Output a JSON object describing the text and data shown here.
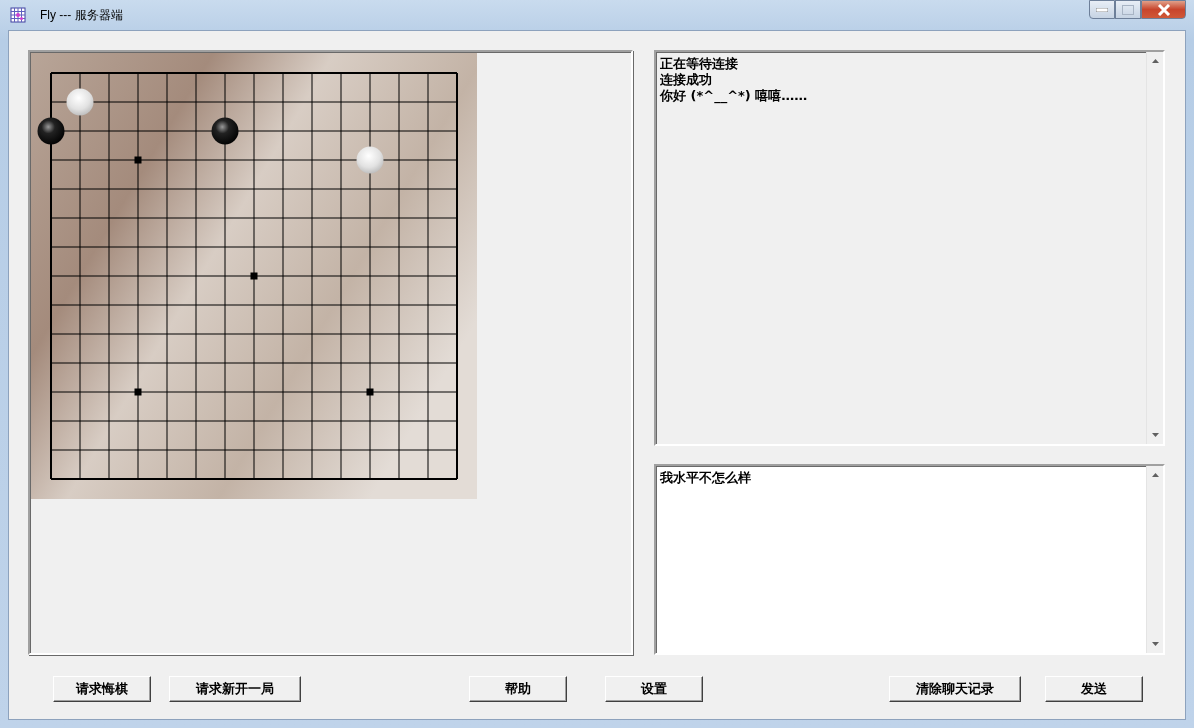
{
  "window": {
    "title": "Fly --- 服务器端"
  },
  "board": {
    "rows": [
      {
        "points": [
          {
            "kind": "empty"
          },
          {
            "kind": "empty"
          },
          {
            "kind": "empty"
          },
          {
            "kind": "empty"
          },
          {
            "kind": "empty"
          },
          {
            "kind": "empty"
          },
          {
            "kind": "empty"
          },
          {
            "kind": "empty"
          },
          {
            "kind": "empty"
          },
          {
            "kind": "empty"
          },
          {
            "kind": "empty"
          },
          {
            "kind": "empty"
          },
          {
            "kind": "empty"
          },
          {
            "kind": "empty"
          },
          {
            "kind": "empty"
          }
        ]
      },
      {
        "points": [
          {
            "kind": "empty"
          },
          {
            "kind": "white"
          },
          {
            "kind": "empty"
          },
          {
            "kind": "empty"
          },
          {
            "kind": "empty"
          },
          {
            "kind": "empty"
          },
          {
            "kind": "empty"
          },
          {
            "kind": "empty"
          },
          {
            "kind": "empty"
          },
          {
            "kind": "empty"
          },
          {
            "kind": "empty"
          },
          {
            "kind": "empty"
          },
          {
            "kind": "empty"
          },
          {
            "kind": "empty"
          },
          {
            "kind": "empty"
          }
        ]
      },
      {
        "points": [
          {
            "kind": "black"
          },
          {
            "kind": "empty"
          },
          {
            "kind": "empty"
          },
          {
            "kind": "empty"
          },
          {
            "kind": "empty"
          },
          {
            "kind": "empty"
          },
          {
            "kind": "black"
          },
          {
            "kind": "empty"
          },
          {
            "kind": "empty"
          },
          {
            "kind": "empty"
          },
          {
            "kind": "empty"
          },
          {
            "kind": "empty"
          },
          {
            "kind": "empty"
          },
          {
            "kind": "empty"
          },
          {
            "kind": "empty"
          }
        ]
      },
      {
        "points": [
          {
            "kind": "empty"
          },
          {
            "kind": "empty"
          },
          {
            "kind": "empty"
          },
          {
            "kind": "empty"
          },
          {
            "kind": "empty"
          },
          {
            "kind": "empty"
          },
          {
            "kind": "empty"
          },
          {
            "kind": "empty"
          },
          {
            "kind": "empty"
          },
          {
            "kind": "empty"
          },
          {
            "kind": "empty"
          },
          {
            "kind": "white"
          },
          {
            "kind": "empty"
          },
          {
            "kind": "empty"
          },
          {
            "kind": "empty"
          }
        ]
      },
      {
        "points": [
          {
            "kind": "empty"
          },
          {
            "kind": "empty"
          },
          {
            "kind": "empty"
          },
          {
            "kind": "empty"
          },
          {
            "kind": "empty"
          },
          {
            "kind": "empty"
          },
          {
            "kind": "empty"
          },
          {
            "kind": "empty"
          },
          {
            "kind": "empty"
          },
          {
            "kind": "empty"
          },
          {
            "kind": "empty"
          },
          {
            "kind": "empty"
          },
          {
            "kind": "empty"
          },
          {
            "kind": "empty"
          },
          {
            "kind": "empty"
          }
        ]
      },
      {
        "points": [
          {
            "kind": "empty"
          },
          {
            "kind": "empty"
          },
          {
            "kind": "empty"
          },
          {
            "kind": "empty"
          },
          {
            "kind": "empty"
          },
          {
            "kind": "empty"
          },
          {
            "kind": "empty"
          },
          {
            "kind": "empty"
          },
          {
            "kind": "empty"
          },
          {
            "kind": "empty"
          },
          {
            "kind": "empty"
          },
          {
            "kind": "empty"
          },
          {
            "kind": "empty"
          },
          {
            "kind": "empty"
          },
          {
            "kind": "empty"
          }
        ]
      },
      {
        "points": [
          {
            "kind": "empty"
          },
          {
            "kind": "empty"
          },
          {
            "kind": "empty"
          },
          {
            "kind": "empty"
          },
          {
            "kind": "empty"
          },
          {
            "kind": "empty"
          },
          {
            "kind": "empty"
          },
          {
            "kind": "empty"
          },
          {
            "kind": "empty"
          },
          {
            "kind": "empty"
          },
          {
            "kind": "empty"
          },
          {
            "kind": "empty"
          },
          {
            "kind": "empty"
          },
          {
            "kind": "empty"
          },
          {
            "kind": "empty"
          }
        ]
      },
      {
        "points": [
          {
            "kind": "empty"
          },
          {
            "kind": "empty"
          },
          {
            "kind": "empty"
          },
          {
            "kind": "empty"
          },
          {
            "kind": "empty"
          },
          {
            "kind": "empty"
          },
          {
            "kind": "empty"
          },
          {
            "kind": "empty"
          },
          {
            "kind": "empty"
          },
          {
            "kind": "empty"
          },
          {
            "kind": "empty"
          },
          {
            "kind": "empty"
          },
          {
            "kind": "empty"
          },
          {
            "kind": "empty"
          },
          {
            "kind": "empty"
          }
        ]
      },
      {
        "points": [
          {
            "kind": "empty"
          },
          {
            "kind": "empty"
          },
          {
            "kind": "empty"
          },
          {
            "kind": "empty"
          },
          {
            "kind": "empty"
          },
          {
            "kind": "empty"
          },
          {
            "kind": "empty"
          },
          {
            "kind": "empty"
          },
          {
            "kind": "empty"
          },
          {
            "kind": "empty"
          },
          {
            "kind": "empty"
          },
          {
            "kind": "empty"
          },
          {
            "kind": "empty"
          },
          {
            "kind": "empty"
          },
          {
            "kind": "empty"
          }
        ]
      },
      {
        "points": [
          {
            "kind": "empty"
          },
          {
            "kind": "empty"
          },
          {
            "kind": "empty"
          },
          {
            "kind": "empty"
          },
          {
            "kind": "empty"
          },
          {
            "kind": "empty"
          },
          {
            "kind": "empty"
          },
          {
            "kind": "empty"
          },
          {
            "kind": "empty"
          },
          {
            "kind": "empty"
          },
          {
            "kind": "empty"
          },
          {
            "kind": "empty"
          },
          {
            "kind": "empty"
          },
          {
            "kind": "empty"
          },
          {
            "kind": "empty"
          }
        ]
      },
      {
        "points": [
          {
            "kind": "empty"
          },
          {
            "kind": "empty"
          },
          {
            "kind": "empty"
          },
          {
            "kind": "empty"
          },
          {
            "kind": "empty"
          },
          {
            "kind": "empty"
          },
          {
            "kind": "empty"
          },
          {
            "kind": "empty"
          },
          {
            "kind": "empty"
          },
          {
            "kind": "empty"
          },
          {
            "kind": "empty"
          },
          {
            "kind": "empty"
          },
          {
            "kind": "empty"
          },
          {
            "kind": "empty"
          },
          {
            "kind": "empty"
          }
        ]
      },
      {
        "points": [
          {
            "kind": "empty"
          },
          {
            "kind": "empty"
          },
          {
            "kind": "empty"
          },
          {
            "kind": "empty"
          },
          {
            "kind": "empty"
          },
          {
            "kind": "empty"
          },
          {
            "kind": "empty"
          },
          {
            "kind": "empty"
          },
          {
            "kind": "empty"
          },
          {
            "kind": "empty"
          },
          {
            "kind": "empty"
          },
          {
            "kind": "empty"
          },
          {
            "kind": "empty"
          },
          {
            "kind": "empty"
          },
          {
            "kind": "empty"
          }
        ]
      },
      {
        "points": [
          {
            "kind": "empty"
          },
          {
            "kind": "empty"
          },
          {
            "kind": "empty"
          },
          {
            "kind": "empty"
          },
          {
            "kind": "empty"
          },
          {
            "kind": "empty"
          },
          {
            "kind": "empty"
          },
          {
            "kind": "empty"
          },
          {
            "kind": "empty"
          },
          {
            "kind": "empty"
          },
          {
            "kind": "empty"
          },
          {
            "kind": "empty"
          },
          {
            "kind": "empty"
          },
          {
            "kind": "empty"
          },
          {
            "kind": "empty"
          }
        ]
      },
      {
        "points": [
          {
            "kind": "empty"
          },
          {
            "kind": "empty"
          },
          {
            "kind": "empty"
          },
          {
            "kind": "empty"
          },
          {
            "kind": "empty"
          },
          {
            "kind": "empty"
          },
          {
            "kind": "empty"
          },
          {
            "kind": "empty"
          },
          {
            "kind": "empty"
          },
          {
            "kind": "empty"
          },
          {
            "kind": "empty"
          },
          {
            "kind": "empty"
          },
          {
            "kind": "empty"
          },
          {
            "kind": "empty"
          },
          {
            "kind": "empty"
          }
        ]
      },
      {
        "points": [
          {
            "kind": "empty"
          },
          {
            "kind": "empty"
          },
          {
            "kind": "empty"
          },
          {
            "kind": "empty"
          },
          {
            "kind": "empty"
          },
          {
            "kind": "empty"
          },
          {
            "kind": "empty"
          },
          {
            "kind": "empty"
          },
          {
            "kind": "empty"
          },
          {
            "kind": "empty"
          },
          {
            "kind": "empty"
          },
          {
            "kind": "empty"
          },
          {
            "kind": "empty"
          },
          {
            "kind": "empty"
          },
          {
            "kind": "empty"
          }
        ]
      }
    ]
  },
  "chat_log": {
    "lines": [
      "正在等待连接",
      "连接成功",
      "你好 (*^__^*) 嘻嘻……"
    ]
  },
  "message_input": {
    "value": "我水平不怎么样"
  },
  "buttons": [
    "请求悔棋",
    "请求新开一局",
    "帮助",
    "设置",
    "清除聊天记录",
    "发送"
  ]
}
